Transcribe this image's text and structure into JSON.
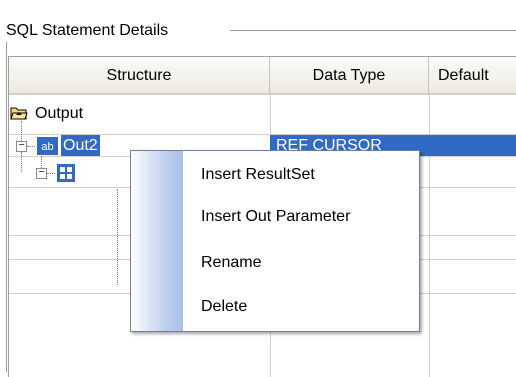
{
  "group": {
    "title": "SQL Statement Details"
  },
  "grid": {
    "columns": [
      "Structure",
      "Data Type",
      "Default"
    ],
    "rows": [
      {
        "name": "Output",
        "type": ""
      },
      {
        "name": "Out2",
        "type": "REF CURSOR"
      }
    ]
  },
  "icons": {
    "folder": "folder-open-icon",
    "param": "ab-parameter-icon",
    "resultset": "resultset-icon"
  },
  "colors": {
    "selection": "#316ac5",
    "menu_gradient": "#a8bfe6"
  },
  "context_menu": {
    "items": [
      "Insert ResultSet",
      "Insert Out Parameter",
      "Rename",
      "Delete"
    ]
  }
}
